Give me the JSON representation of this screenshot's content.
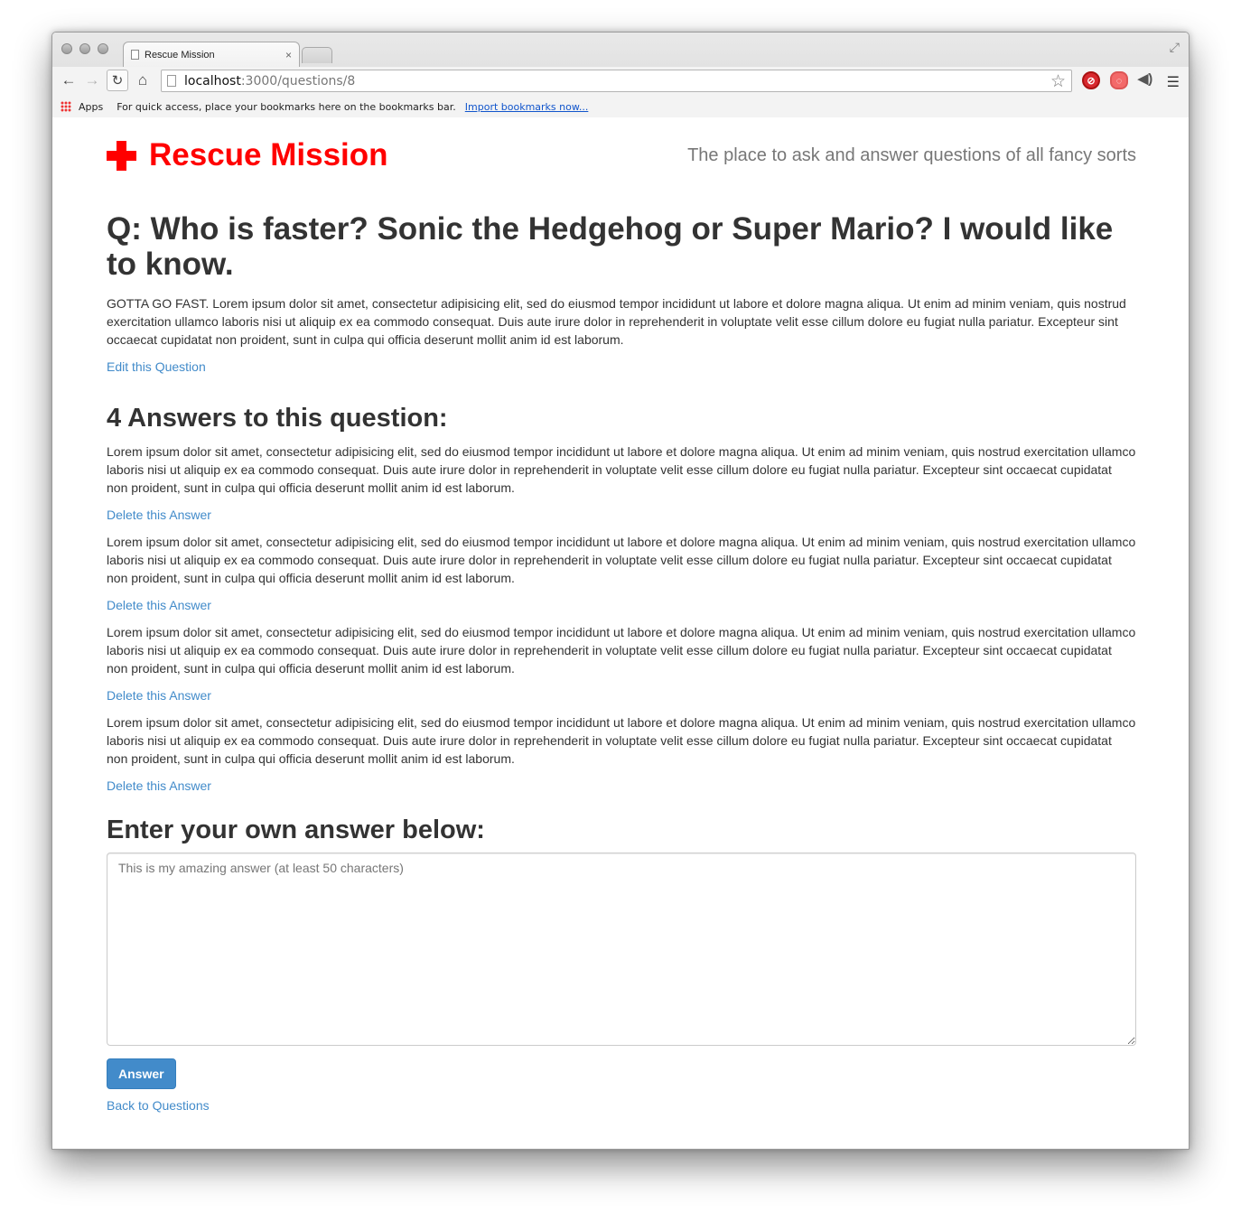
{
  "browser": {
    "tab_title": "Rescue Mission",
    "tab_close": "×",
    "url_host": "localhost",
    "url_rest": ":3000/questions/8",
    "apps_label": "Apps",
    "bookmarks_message": "For quick access, place your bookmarks here on the bookmarks bar.",
    "bookmarks_import_link": "Import bookmarks now..."
  },
  "site": {
    "name": "Rescue Mission",
    "tagline": "The place to ask and answer questions of all fancy sorts"
  },
  "question": {
    "title": "Q: Who is faster? Sonic the Hedgehog or Super Mario? I would like to know.",
    "body": "GOTTA GO FAST. Lorem ipsum dolor sit amet, consectetur adipisicing elit, sed do eiusmod tempor incididunt ut labore et dolore magna aliqua. Ut enim ad minim veniam, quis nostrud exercitation ullamco laboris nisi ut aliquip ex ea commodo consequat. Duis aute irure dolor in reprehenderit in voluptate velit esse cillum dolore eu fugiat nulla pariatur. Excepteur sint occaecat cupidatat non proident, sunt in culpa qui officia deserunt mollit anim id est laborum.",
    "edit_link": "Edit this Question"
  },
  "answers": {
    "heading": "4 Answers to this question:",
    "items": [
      {
        "body": "Lorem ipsum dolor sit amet, consectetur adipisicing elit, sed do eiusmod tempor incididunt ut labore et dolore magna aliqua. Ut enim ad minim veniam, quis nostrud exercitation ullamco laboris nisi ut aliquip ex ea commodo consequat. Duis aute irure dolor in reprehenderit in voluptate velit esse cillum dolore eu fugiat nulla pariatur. Excepteur sint occaecat cupidatat non proident, sunt in culpa qui officia deserunt mollit anim id est laborum.",
        "delete_label": "Delete this Answer"
      },
      {
        "body": "Lorem ipsum dolor sit amet, consectetur adipisicing elit, sed do eiusmod tempor incididunt ut labore et dolore magna aliqua. Ut enim ad minim veniam, quis nostrud exercitation ullamco laboris nisi ut aliquip ex ea commodo consequat. Duis aute irure dolor in reprehenderit in voluptate velit esse cillum dolore eu fugiat nulla pariatur. Excepteur sint occaecat cupidatat non proident, sunt in culpa qui officia deserunt mollit anim id est laborum.",
        "delete_label": "Delete this Answer"
      },
      {
        "body": "Lorem ipsum dolor sit amet, consectetur adipisicing elit, sed do eiusmod tempor incididunt ut labore et dolore magna aliqua. Ut enim ad minim veniam, quis nostrud exercitation ullamco laboris nisi ut aliquip ex ea commodo consequat. Duis aute irure dolor in reprehenderit in voluptate velit esse cillum dolore eu fugiat nulla pariatur. Excepteur sint occaecat cupidatat non proident, sunt in culpa qui officia deserunt mollit anim id est laborum.",
        "delete_label": "Delete this Answer"
      },
      {
        "body": "Lorem ipsum dolor sit amet, consectetur adipisicing elit, sed do eiusmod tempor incididunt ut labore et dolore magna aliqua. Ut enim ad minim veniam, quis nostrud exercitation ullamco laboris nisi ut aliquip ex ea commodo consequat. Duis aute irure dolor in reprehenderit in voluptate velit esse cillum dolore eu fugiat nulla pariatur. Excepteur sint occaecat cupidatat non proident, sunt in culpa qui officia deserunt mollit anim id est laborum.",
        "delete_label": "Delete this Answer"
      }
    ]
  },
  "answer_form": {
    "heading": "Enter your own answer below:",
    "value": "",
    "placeholder": "This is my amazing answer (at least 50 characters)",
    "submit_label": "Answer",
    "back_link": "Back to Questions"
  },
  "colors": {
    "brand_red": "#ff0000",
    "link_blue": "#428bca",
    "button_blue": "#428bca"
  }
}
